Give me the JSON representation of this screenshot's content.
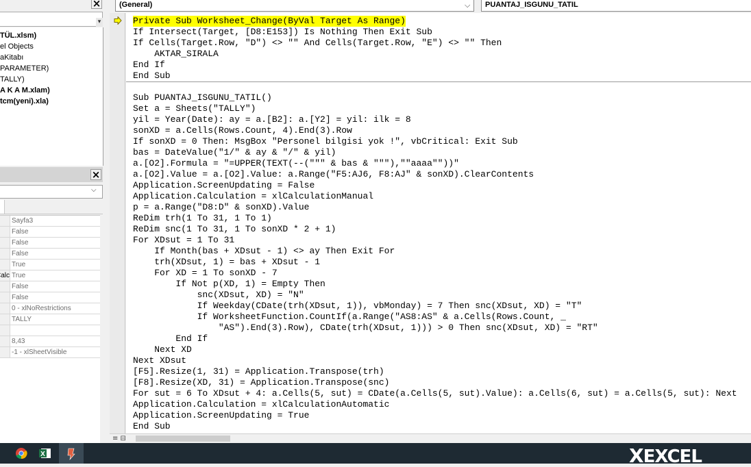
{
  "project_explorer": {
    "items": [
      {
        "label": "TÜL.xlsm)",
        "bold": true
      },
      {
        "label": "el Objects",
        "bold": false
      },
      {
        "label": "aKitabı",
        "bold": false
      },
      {
        "label": "PARAMETER)",
        "bold": false
      },
      {
        "label": "TALLY)",
        "bold": false
      },
      {
        "label": "A K A M.xlam)",
        "bold": true
      },
      {
        "label": "tcm(yeni).xla)",
        "bold": true
      }
    ]
  },
  "properties": {
    "rows": [
      {
        "name": "",
        "value": "Sayfa3"
      },
      {
        "name": "",
        "value": "False"
      },
      {
        "name": "",
        "value": "False"
      },
      {
        "name": "",
        "value": "False"
      },
      {
        "name": "",
        "value": "True"
      },
      {
        "name": "Calc",
        "value": "True"
      },
      {
        "name": "",
        "value": "False"
      },
      {
        "name": "",
        "value": "False"
      },
      {
        "name": "",
        "value": "0 - xlNoRestrictions"
      },
      {
        "name": "",
        "value": "TALLY"
      },
      {
        "name": "",
        "value": ""
      },
      {
        "name": "",
        "value": "8,43"
      },
      {
        "name": "",
        "value": "-1 - xlSheetVisible"
      }
    ]
  },
  "code_window": {
    "object_combo": "(General)",
    "procedure_combo": "PUANTAJ_ISGUNU_TATIL",
    "event_lines": [
      "Private Sub Worksheet_Change(ByVal Target As Range)",
      "If Intersect(Target, [D8:E153]) Is Nothing Then Exit Sub",
      "If Cells(Target.Row, \"D\") <> \"\" And Cells(Target.Row, \"E\") <> \"\" Then",
      "    AKTAR_SIRALA",
      "End If",
      "End Sub"
    ],
    "sub_lines": [
      "Sub PUANTAJ_ISGUNU_TATIL()",
      "Set a = Sheets(\"TALLY\")",
      "yil = Year(Date): ay = a.[B2]: a.[Y2] = yil: ilk = 8",
      "sonXD = a.Cells(Rows.Count, 4).End(3).Row",
      "If sonXD = 0 Then: MsgBox \"Personel bilgisi yok !\", vbCritical: Exit Sub",
      "bas = DateValue(\"1/\" & ay & \"/\" & yil)",
      "a.[O2].Formula = \"=UPPER(TEXT(--(\"\"\" & bas & \"\"\"),\"\"aaaa\"\"))\"",
      "a.[O2].Value = a.[O2].Value: a.Range(\"F5:AJ6, F8:AJ\" & sonXD).ClearContents",
      "Application.ScreenUpdating = False",
      "Application.Calculation = xlCalculationManual",
      "p = a.Range(\"D8:D\" & sonXD).Value",
      "ReDim trh(1 To 31, 1 To 1)",
      "ReDim snc(1 To 31, 1 To sonXD * 2 + 1)",
      "For XDsut = 1 To 31",
      "    If Month(bas + XDsut - 1) <> ay Then Exit For",
      "    trh(XDsut, 1) = bas + XDsut - 1",
      "    For XD = 1 To sonXD - 7",
      "        If Not p(XD, 1) = Empty Then",
      "            snc(XDsut, XD) = \"N\"",
      "            If Weekday(CDate(trh(XDsut, 1)), vbMonday) = 7 Then snc(XDsut, XD) = \"T\"",
      "            If WorksheetFunction.CountIf(a.Range(\"AS8:AS\" & a.Cells(Rows.Count, _",
      "                \"AS\").End(3).Row), CDate(trh(XDsut, 1))) > 0 Then snc(XDsut, XD) = \"RT\"",
      "        End If",
      "    Next XD",
      "Next XDsut",
      "[F5].Resize(1, 31) = Application.Transpose(trh)",
      "[F8].Resize(XD, 31) = Application.Transpose(snc)",
      "For sut = 6 To XDsut + 4: a.Cells(5, sut) = CDate(a.Cells(5, sut).Value): a.Cells(6, sut) = a.Cells(5, sut): Next",
      "Application.Calculation = xlCalculationAutomatic",
      "Application.ScreenUpdating = True",
      "End Sub"
    ]
  },
  "taskbar": {
    "apps": [
      "chrome-icon",
      "excel-icon",
      "vba-editor-icon"
    ],
    "watermark": "EXCEL"
  },
  "colors": {
    "execution_highlight": "#ffff00",
    "taskbar": "#1e2a33"
  }
}
